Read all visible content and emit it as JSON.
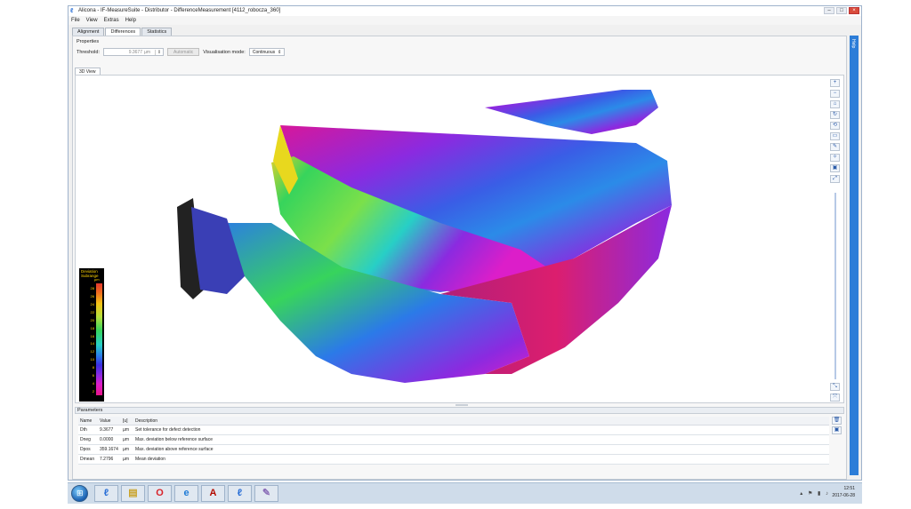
{
  "window": {
    "title": "Alicona - IF-MeasureSuite - Distributor - DifferenceMeasurement  [4112_robocza_360]"
  },
  "menu": [
    "File",
    "View",
    "Extras",
    "Help"
  ],
  "tabs": [
    "Alignment",
    "Differences",
    "Statistics"
  ],
  "properties": {
    "header": "Properties",
    "threshold_label": "Threshold:",
    "threshold_value": "9.3677",
    "threshold_unit": "µm",
    "automatic_label": "Automatic",
    "vis_label": "Visualisation mode:",
    "vis_value": "Continuous"
  },
  "view_tab": "3D View",
  "legend": {
    "title": "Deviation",
    "subtitle": "Subrange",
    "unit": "µm",
    "ticks": [
      "28",
      "26",
      "24",
      "22",
      "20",
      "18",
      "16",
      "14",
      "12",
      "10",
      "8",
      "6",
      "4",
      "2"
    ],
    "colors": [
      "#e4392f",
      "#f4c316",
      "#37d45c",
      "#27cfc6",
      "#2b7ae8",
      "#8b2ae0",
      "#e8158a"
    ]
  },
  "view_tools": [
    "zoom-in-icon",
    "zoom-out-icon",
    "home-icon",
    "rotate-icon",
    "reset-icon",
    "print-icon",
    "measure-icon",
    "light-icon",
    "save-icon",
    "fit-icon"
  ],
  "parameters": {
    "header": "Parameters",
    "columns": [
      "Name",
      "Value",
      "[u]",
      "Description"
    ],
    "rows": [
      {
        "name": "Dth",
        "value": "9.3677",
        "unit": "µm",
        "description": "Set tolerance for defect detection"
      },
      {
        "name": "Dneg",
        "value": "0.0000",
        "unit": "µm",
        "description": "Max. deviation below reference surface"
      },
      {
        "name": "Dpos",
        "value": "359.1674",
        "unit": "µm",
        "description": "Max. deviation above reference surface"
      },
      {
        "name": "Dmean",
        "value": "7.2796",
        "unit": "µm",
        "description": "Mean deviation"
      }
    ]
  },
  "help_label": "Help",
  "taskbar": {
    "time": "12:51",
    "date": "2017-06-28"
  }
}
